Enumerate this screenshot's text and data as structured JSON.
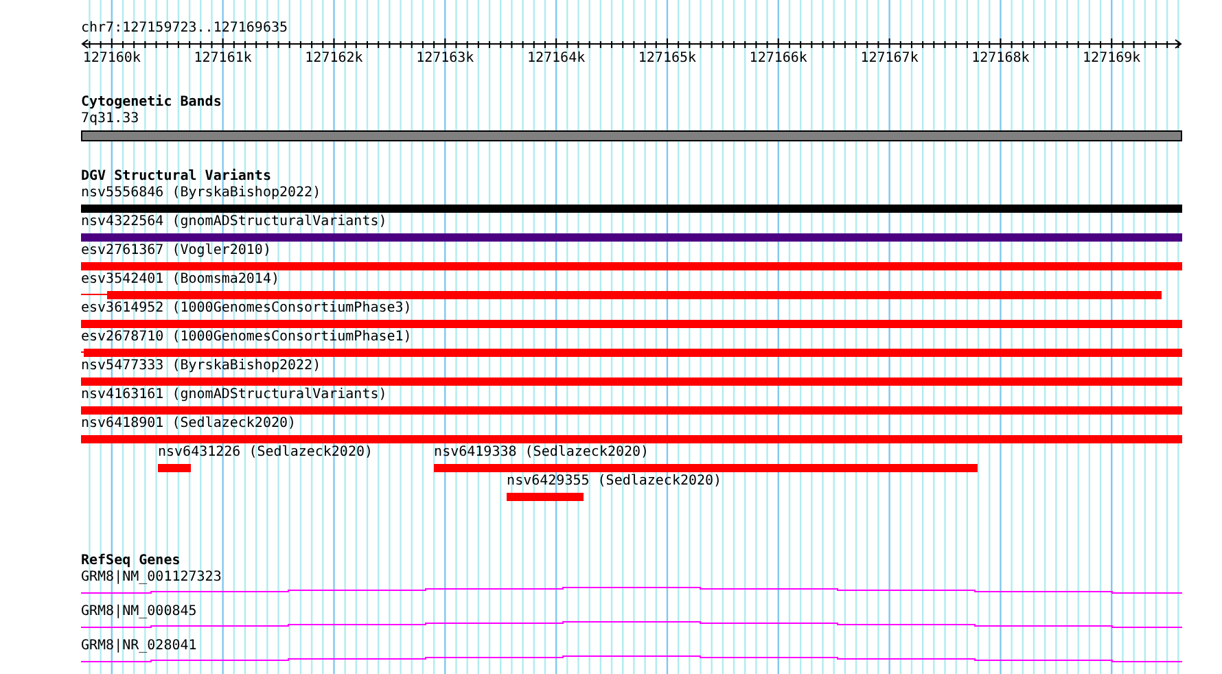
{
  "location": "chr7:127159723..127169635",
  "ruler": {
    "ticks": [
      "127160k",
      "127161k",
      "127162k",
      "127163k",
      "127164k",
      "127165k",
      "127166k",
      "127167k",
      "127168k",
      "127169k"
    ]
  },
  "cytogenetic_bands": {
    "title": "Cytogenetic Bands",
    "band": {
      "label": "7q31.33",
      "color": "#808080"
    }
  },
  "dgv_structural_variants": {
    "title": "DGV Structural Variants",
    "rows": [
      {
        "features": [
          {
            "label": "nsv5556846 (ByrskaBishop2022)",
            "color": "#000000"
          }
        ]
      },
      {
        "features": [
          {
            "label": "nsv4322564 (gnomADStructuralVariants)",
            "color": "#4b0082"
          }
        ]
      },
      {
        "features": [
          {
            "label": "esv2761367 (Vogler2010)",
            "color": "#ff0000"
          }
        ]
      },
      {
        "features": [
          {
            "label": "esv3542401 (Boomsma2014)",
            "color": "#ff0000"
          }
        ]
      },
      {
        "features": [
          {
            "label": "esv3614952 (1000GenomesConsortiumPhase3)",
            "color": "#ff0000"
          }
        ]
      },
      {
        "features": [
          {
            "label": "esv2678710 (1000GenomesConsortiumPhase1)",
            "color": "#ff0000"
          }
        ]
      },
      {
        "features": [
          {
            "label": "nsv5477333 (ByrskaBishop2022)",
            "color": "#ff0000"
          }
        ]
      },
      {
        "features": [
          {
            "label": "nsv4163161 (gnomADStructuralVariants)",
            "color": "#ff0000"
          }
        ]
      },
      {
        "features": [
          {
            "label": "nsv6418901 (Sedlazeck2020)",
            "color": "#ff0000"
          }
        ]
      },
      {
        "features": [
          {
            "label": "nsv6431226 (Sedlazeck2020)",
            "color": "#ff0000"
          },
          {
            "label": "nsv6419338 (Sedlazeck2020)",
            "color": "#ff0000"
          }
        ]
      },
      {
        "features": [
          {
            "label": "nsv6429355 (Sedlazeck2020)",
            "color": "#ff0000"
          }
        ]
      }
    ]
  },
  "refseq_genes": {
    "title": "RefSeq Genes",
    "genes": [
      {
        "label": "GRM8|NM_001127323"
      },
      {
        "label": "GRM8|NM_000845"
      },
      {
        "label": "GRM8|NR_028041"
      }
    ]
  }
}
